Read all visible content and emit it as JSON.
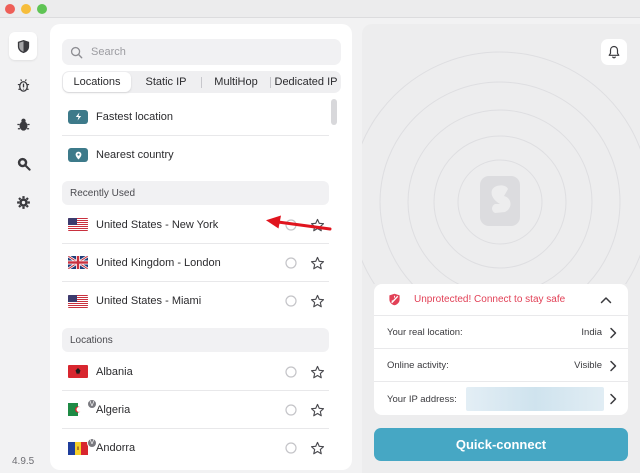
{
  "app": {
    "version": "4.9.5"
  },
  "sidebar": {
    "items": [
      {
        "icon": "shield-icon",
        "active": true
      },
      {
        "icon": "bug-alert-icon",
        "active": false
      },
      {
        "icon": "bug-icon",
        "active": false
      },
      {
        "icon": "search-zoom-icon",
        "active": false
      },
      {
        "icon": "gear-icon",
        "active": false
      }
    ]
  },
  "search": {
    "placeholder": "Search"
  },
  "tabs": [
    {
      "label": "Locations",
      "active": true
    },
    {
      "label": "Static IP",
      "active": false
    },
    {
      "label": "MultiHop",
      "active": false
    },
    {
      "label": "Dedicated IP",
      "active": false
    }
  ],
  "quick_options": [
    {
      "label": "Fastest location",
      "icon": "lightning-icon"
    },
    {
      "label": "Nearest country",
      "icon": "location-pin-icon"
    }
  ],
  "recently_used": {
    "header": "Recently Used",
    "items": [
      {
        "label": "United States - New York",
        "flag": "us"
      },
      {
        "label": "United Kingdom - London",
        "flag": "uk"
      },
      {
        "label": "United States - Miami",
        "flag": "us"
      }
    ]
  },
  "locations": {
    "header": "Locations",
    "items": [
      {
        "label": "Albania",
        "flag": "al",
        "virtual": false
      },
      {
        "label": "Algeria",
        "flag": "dz",
        "virtual": true,
        "badge": "V"
      },
      {
        "label": "Andorra",
        "flag": "ad",
        "virtual": true,
        "badge": "V"
      }
    ]
  },
  "status_card": {
    "message": "Unprotected! Connect to stay safe",
    "rows": [
      {
        "key": "Your real location:",
        "value": "India"
      },
      {
        "key": "Online activity:",
        "value": "Visible"
      },
      {
        "key": "Your IP address:",
        "value": ""
      }
    ]
  },
  "quick_connect": {
    "label": "Quick-connect"
  },
  "colors": {
    "accent": "#46a7c4",
    "danger": "#e24157",
    "arrow": "#e0141e"
  }
}
